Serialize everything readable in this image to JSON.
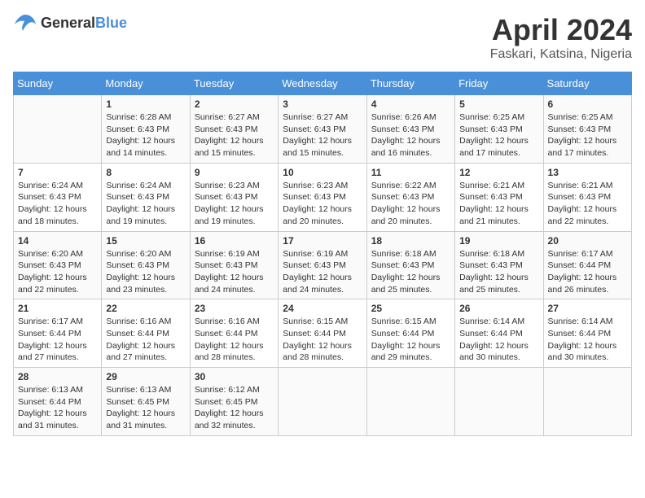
{
  "header": {
    "logo": {
      "text_general": "General",
      "text_blue": "Blue"
    },
    "title": "April 2024",
    "location": "Faskari, Katsina, Nigeria"
  },
  "calendar": {
    "days_of_week": [
      "Sunday",
      "Monday",
      "Tuesday",
      "Wednesday",
      "Thursday",
      "Friday",
      "Saturday"
    ],
    "weeks": [
      [
        {
          "day": "",
          "info": ""
        },
        {
          "day": "1",
          "info": "Sunrise: 6:28 AM\nSunset: 6:43 PM\nDaylight: 12 hours\nand 14 minutes."
        },
        {
          "day": "2",
          "info": "Sunrise: 6:27 AM\nSunset: 6:43 PM\nDaylight: 12 hours\nand 15 minutes."
        },
        {
          "day": "3",
          "info": "Sunrise: 6:27 AM\nSunset: 6:43 PM\nDaylight: 12 hours\nand 15 minutes."
        },
        {
          "day": "4",
          "info": "Sunrise: 6:26 AM\nSunset: 6:43 PM\nDaylight: 12 hours\nand 16 minutes."
        },
        {
          "day": "5",
          "info": "Sunrise: 6:25 AM\nSunset: 6:43 PM\nDaylight: 12 hours\nand 17 minutes."
        },
        {
          "day": "6",
          "info": "Sunrise: 6:25 AM\nSunset: 6:43 PM\nDaylight: 12 hours\nand 17 minutes."
        }
      ],
      [
        {
          "day": "7",
          "info": "Sunrise: 6:24 AM\nSunset: 6:43 PM\nDaylight: 12 hours\nand 18 minutes."
        },
        {
          "day": "8",
          "info": "Sunrise: 6:24 AM\nSunset: 6:43 PM\nDaylight: 12 hours\nand 19 minutes."
        },
        {
          "day": "9",
          "info": "Sunrise: 6:23 AM\nSunset: 6:43 PM\nDaylight: 12 hours\nand 19 minutes."
        },
        {
          "day": "10",
          "info": "Sunrise: 6:23 AM\nSunset: 6:43 PM\nDaylight: 12 hours\nand 20 minutes."
        },
        {
          "day": "11",
          "info": "Sunrise: 6:22 AM\nSunset: 6:43 PM\nDaylight: 12 hours\nand 20 minutes."
        },
        {
          "day": "12",
          "info": "Sunrise: 6:21 AM\nSunset: 6:43 PM\nDaylight: 12 hours\nand 21 minutes."
        },
        {
          "day": "13",
          "info": "Sunrise: 6:21 AM\nSunset: 6:43 PM\nDaylight: 12 hours\nand 22 minutes."
        }
      ],
      [
        {
          "day": "14",
          "info": "Sunrise: 6:20 AM\nSunset: 6:43 PM\nDaylight: 12 hours\nand 22 minutes."
        },
        {
          "day": "15",
          "info": "Sunrise: 6:20 AM\nSunset: 6:43 PM\nDaylight: 12 hours\nand 23 minutes."
        },
        {
          "day": "16",
          "info": "Sunrise: 6:19 AM\nSunset: 6:43 PM\nDaylight: 12 hours\nand 24 minutes."
        },
        {
          "day": "17",
          "info": "Sunrise: 6:19 AM\nSunset: 6:43 PM\nDaylight: 12 hours\nand 24 minutes."
        },
        {
          "day": "18",
          "info": "Sunrise: 6:18 AM\nSunset: 6:43 PM\nDaylight: 12 hours\nand 25 minutes."
        },
        {
          "day": "19",
          "info": "Sunrise: 6:18 AM\nSunset: 6:43 PM\nDaylight: 12 hours\nand 25 minutes."
        },
        {
          "day": "20",
          "info": "Sunrise: 6:17 AM\nSunset: 6:44 PM\nDaylight: 12 hours\nand 26 minutes."
        }
      ],
      [
        {
          "day": "21",
          "info": "Sunrise: 6:17 AM\nSunset: 6:44 PM\nDaylight: 12 hours\nand 27 minutes."
        },
        {
          "day": "22",
          "info": "Sunrise: 6:16 AM\nSunset: 6:44 PM\nDaylight: 12 hours\nand 27 minutes."
        },
        {
          "day": "23",
          "info": "Sunrise: 6:16 AM\nSunset: 6:44 PM\nDaylight: 12 hours\nand 28 minutes."
        },
        {
          "day": "24",
          "info": "Sunrise: 6:15 AM\nSunset: 6:44 PM\nDaylight: 12 hours\nand 28 minutes."
        },
        {
          "day": "25",
          "info": "Sunrise: 6:15 AM\nSunset: 6:44 PM\nDaylight: 12 hours\nand 29 minutes."
        },
        {
          "day": "26",
          "info": "Sunrise: 6:14 AM\nSunset: 6:44 PM\nDaylight: 12 hours\nand 30 minutes."
        },
        {
          "day": "27",
          "info": "Sunrise: 6:14 AM\nSunset: 6:44 PM\nDaylight: 12 hours\nand 30 minutes."
        }
      ],
      [
        {
          "day": "28",
          "info": "Sunrise: 6:13 AM\nSunset: 6:44 PM\nDaylight: 12 hours\nand 31 minutes."
        },
        {
          "day": "29",
          "info": "Sunrise: 6:13 AM\nSunset: 6:45 PM\nDaylight: 12 hours\nand 31 minutes."
        },
        {
          "day": "30",
          "info": "Sunrise: 6:12 AM\nSunset: 6:45 PM\nDaylight: 12 hours\nand 32 minutes."
        },
        {
          "day": "",
          "info": ""
        },
        {
          "day": "",
          "info": ""
        },
        {
          "day": "",
          "info": ""
        },
        {
          "day": "",
          "info": ""
        }
      ]
    ]
  }
}
